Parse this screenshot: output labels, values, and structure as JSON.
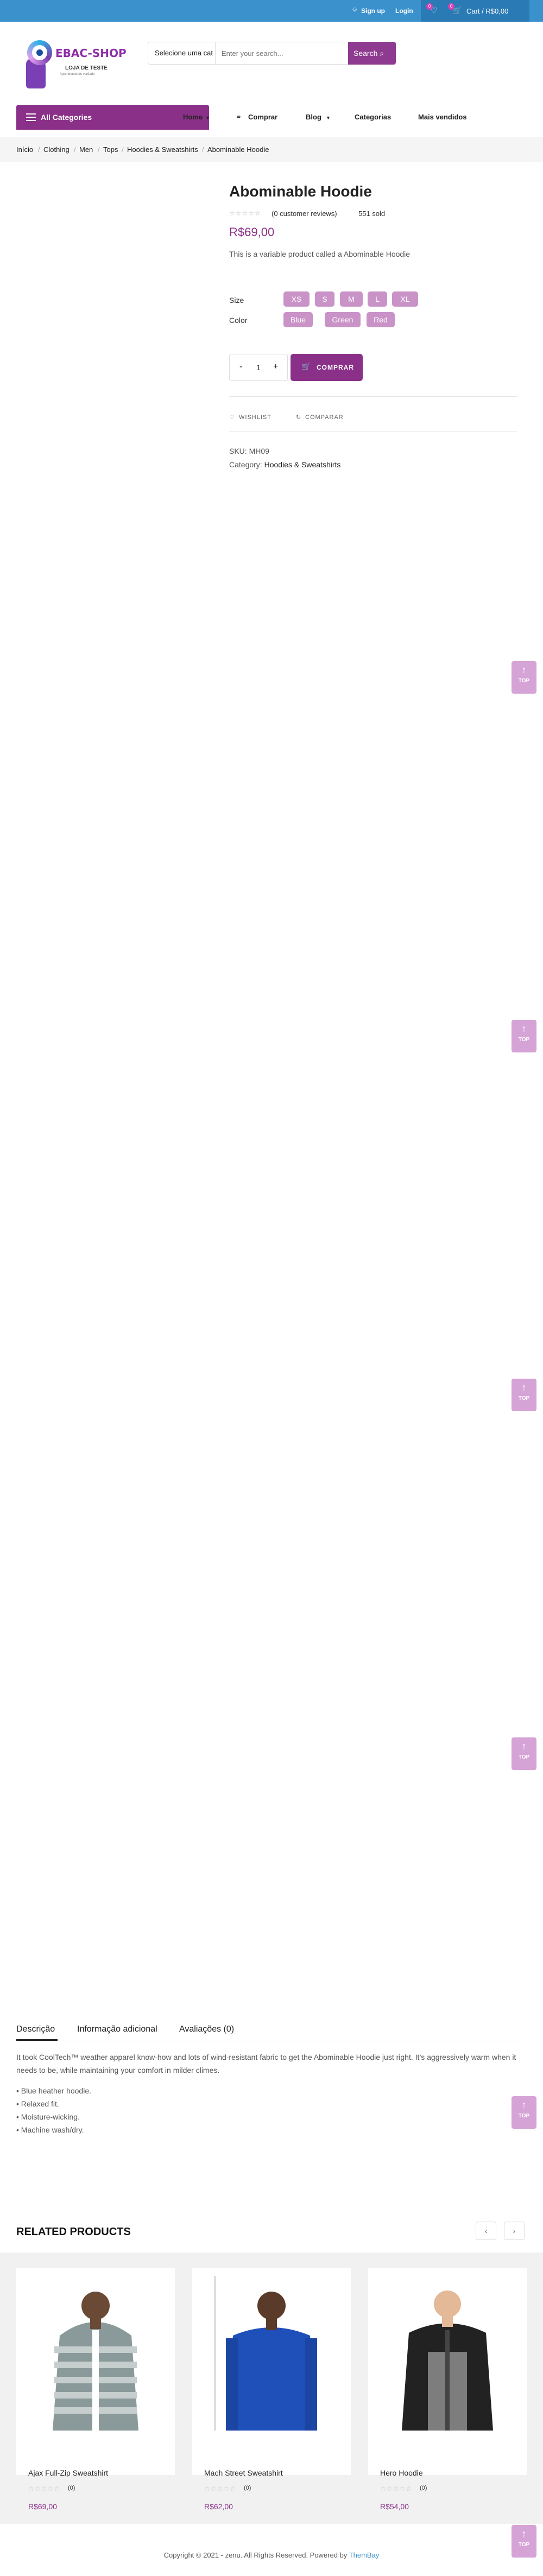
{
  "top": {
    "signup": "Sign up",
    "login": "Login",
    "wish_count": "0",
    "cart_count": "0",
    "cart_label": "Cart / R$0,00"
  },
  "logo": {
    "name": "EBAC-SHOP",
    "sub": "LOJA DE TESTE",
    "tiny": "Aprendendo de verdade"
  },
  "search": {
    "category": "Selecione uma cat",
    "placeholder": "Enter your search...",
    "button": "Search"
  },
  "nav": {
    "all_categories": "All Categories",
    "items": [
      "Home",
      "Comprar",
      "Blog",
      "Categorias",
      "Mais vendidos"
    ]
  },
  "breadcrumb": [
    "Início",
    "Clothing",
    "Men",
    "Tops",
    "Hoodies & Sweatshirts",
    "Abominable Hoodie"
  ],
  "product": {
    "title": "Abominable Hoodie",
    "reviews": "(0 customer reviews)",
    "sold": "551 sold",
    "price": "R$69,00",
    "description": "This is a variable product called a Abominable Hoodie",
    "size_label": "Size",
    "sizes": [
      "XS",
      "S",
      "M",
      "L",
      "XL"
    ],
    "color_label": "Color",
    "colors": [
      "Blue",
      "Green",
      "Red"
    ],
    "qty": "1",
    "buy": "COMPRAR",
    "wishlist": "WISHLIST",
    "compare": "COMPARAR",
    "sku_label": "SKU:",
    "sku": "MH09",
    "category_label": "Category:",
    "category": "Hoodies & Sweatshirts"
  },
  "top_label": "TOP",
  "tabs": [
    "Descrição",
    "Informação adicional",
    "Avaliações (0)"
  ],
  "details": {
    "intro": "It took CoolTech™ weather apparel know-how and lots of wind-resistant fabric to get the Abominable Hoodie just right. It’s aggressively warm when it needs to be, while maintaining your comfort in milder climes.",
    "bullets": [
      "• Blue heather hoodie.",
      "• Relaxed fit.",
      "• Moisture-wicking.",
      "• Machine wash/dry."
    ]
  },
  "related": {
    "title": "RELATED PRODUCTS",
    "items": [
      {
        "name": "Ajax Full-Zip Sweatshirt",
        "price": "R$69,00",
        "count": "(0)"
      },
      {
        "name": "Mach Street Sweatshirt",
        "price": "R$62,00",
        "count": "(0)"
      },
      {
        "name": "Hero Hoodie",
        "price": "R$54,00",
        "count": "(0)"
      }
    ]
  },
  "footer": {
    "text": "Copyright © 2021 - zenu. All Rights Reserved. Powered by",
    "brand": "ThemBay"
  },
  "colors": {
    "purple": "#8a3088",
    "chip": "#c993c8",
    "topbar": "#3a91cc"
  }
}
